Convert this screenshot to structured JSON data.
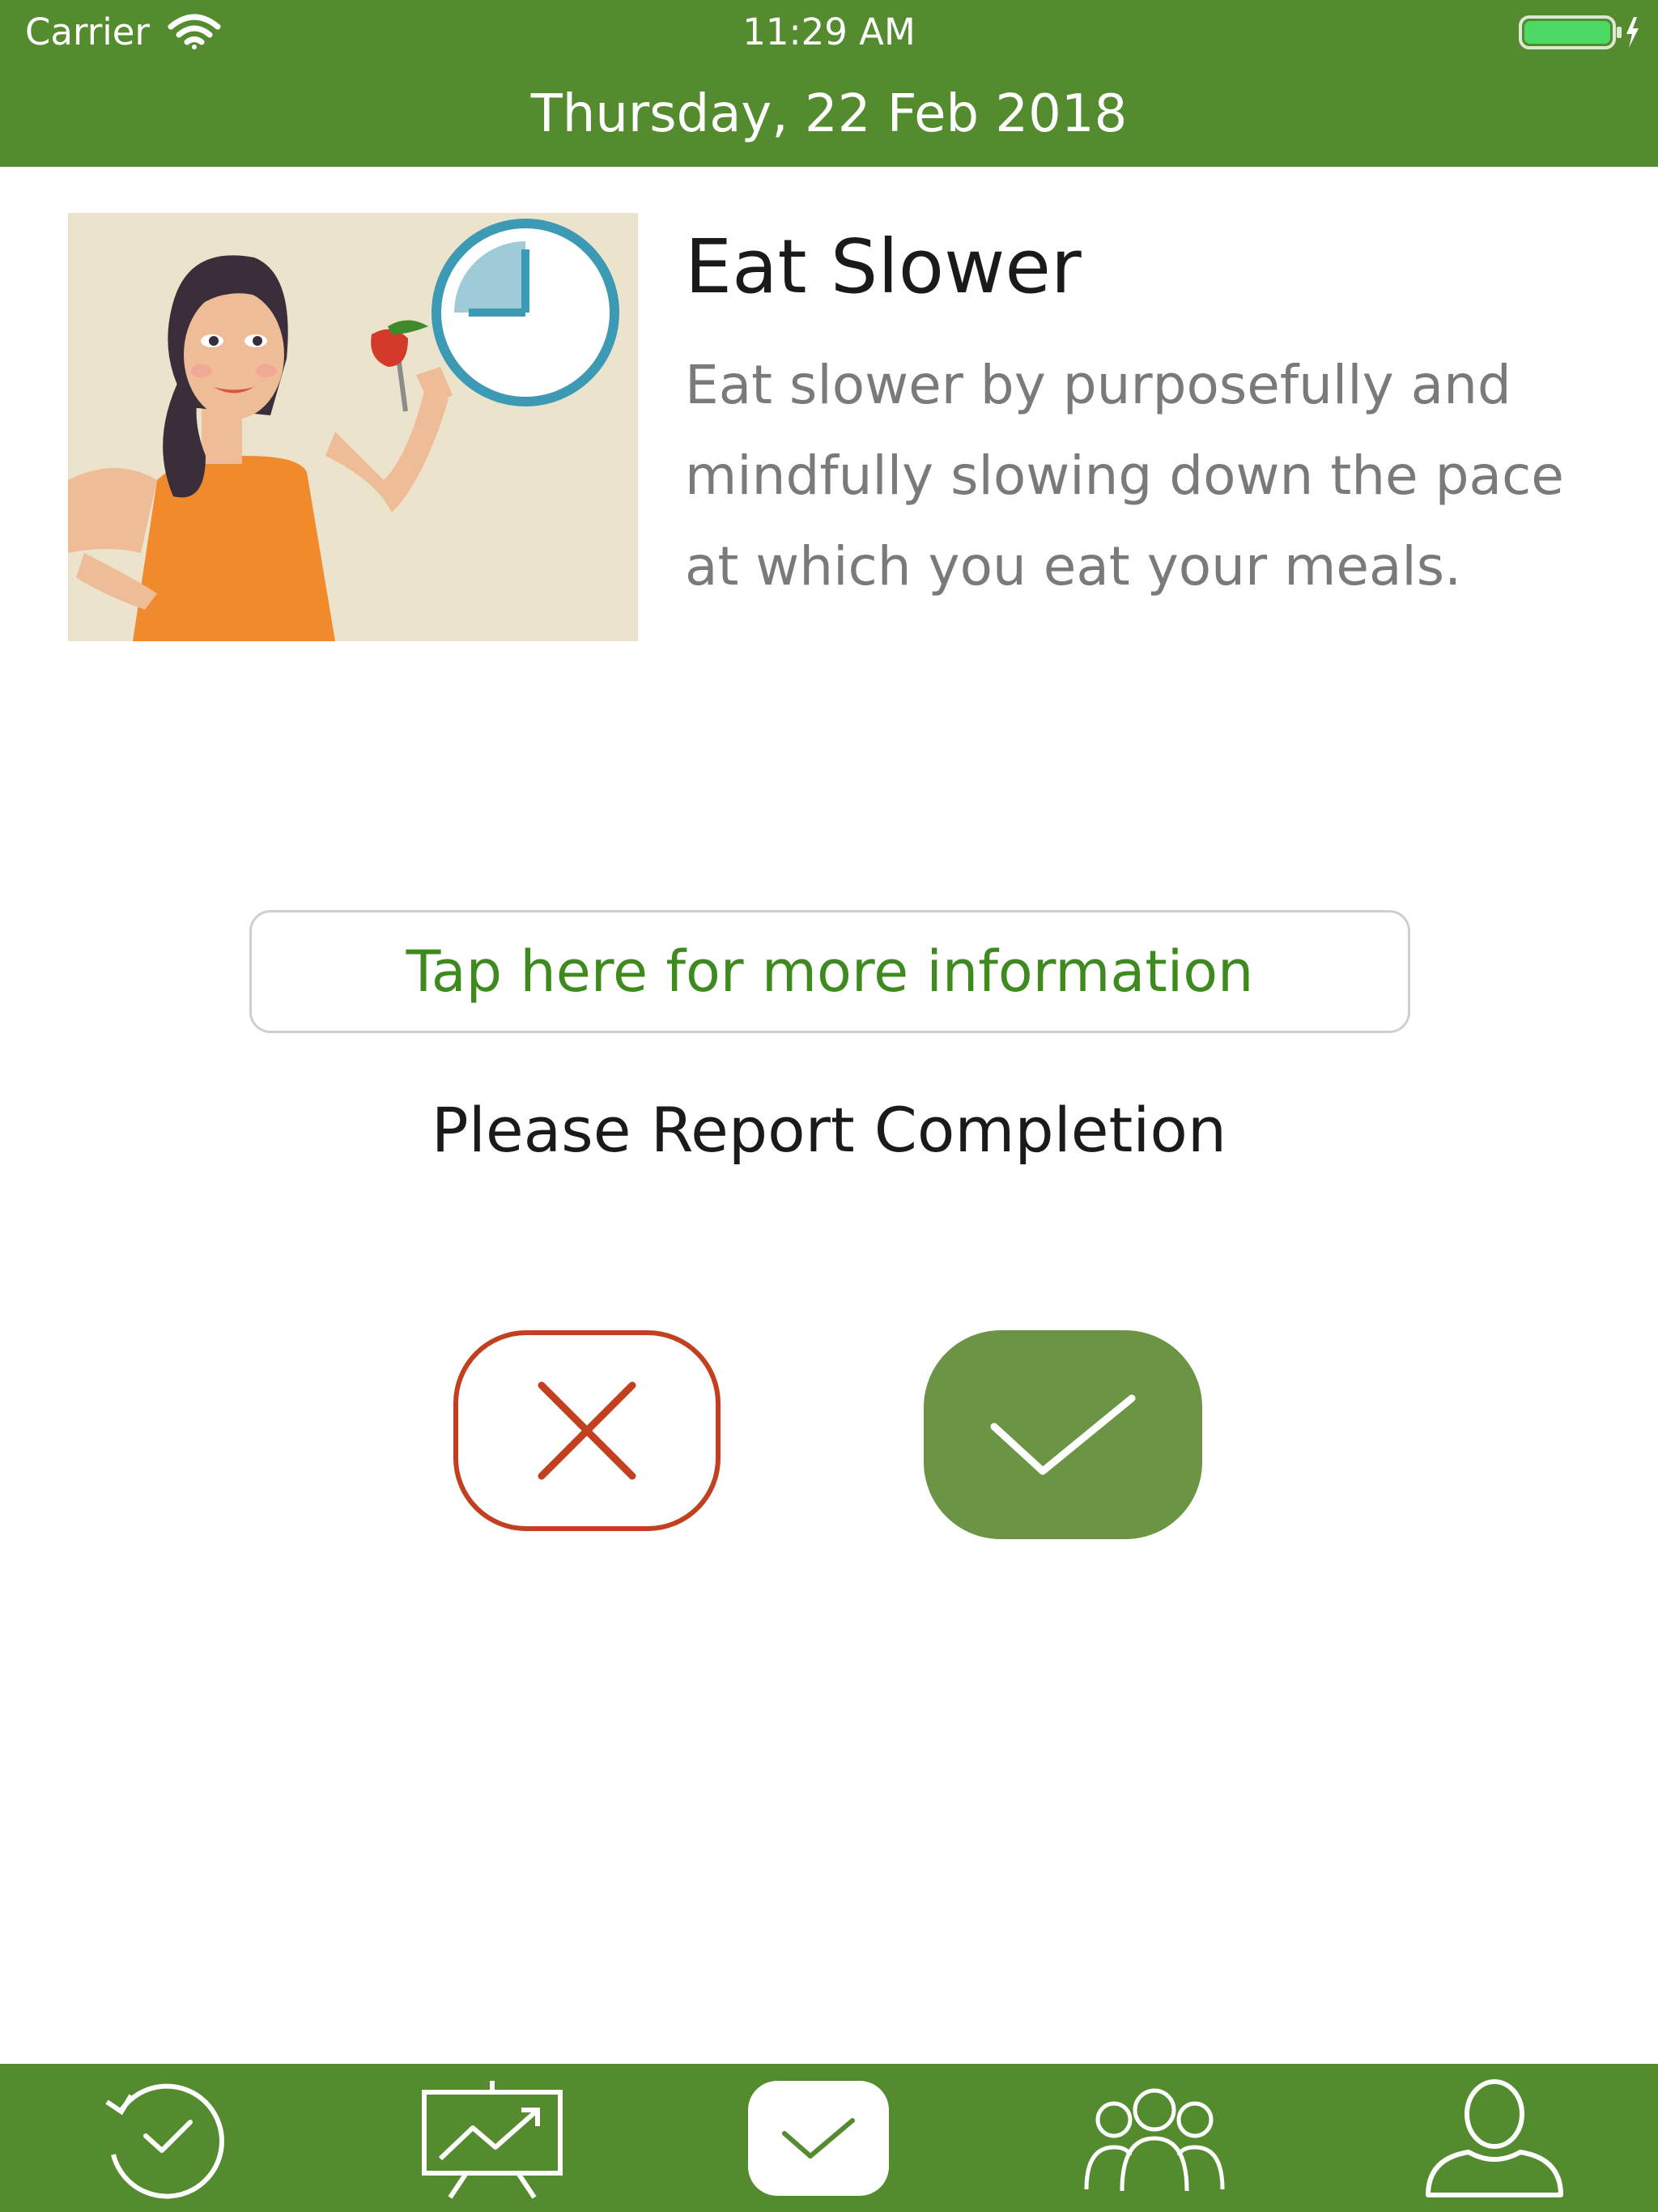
{
  "status_bar": {
    "carrier": "Carrier",
    "time": "11:29 AM",
    "wifi_icon": "wifi-icon",
    "battery_icon": "battery-charging-icon"
  },
  "header": {
    "date": "Thursday, 22 Feb 2018"
  },
  "tip": {
    "title": "Eat Slower",
    "description": "Eat slower by purposefully and mindfully slowing down the pace at which you eat your meals.",
    "illustration_icon": "woman-eating-slowly-illustration"
  },
  "actions": {
    "more_info_label": "Tap here for more information",
    "report_label": "Please Report Completion",
    "decline_icon": "close-icon",
    "complete_icon": "checkmark-icon"
  },
  "tab_bar": {
    "active_index": 2,
    "items": [
      {
        "icon": "history-icon"
      },
      {
        "icon": "progress-chart-icon"
      },
      {
        "icon": "checkmark-icon"
      },
      {
        "icon": "community-icon"
      },
      {
        "icon": "profile-icon"
      }
    ]
  },
  "colors": {
    "brand_green": "#548b2f",
    "complete_green": "#6b9444",
    "decline_red": "#c2401f",
    "link_green": "#3e8a1f",
    "battery_green": "#4cd964"
  }
}
